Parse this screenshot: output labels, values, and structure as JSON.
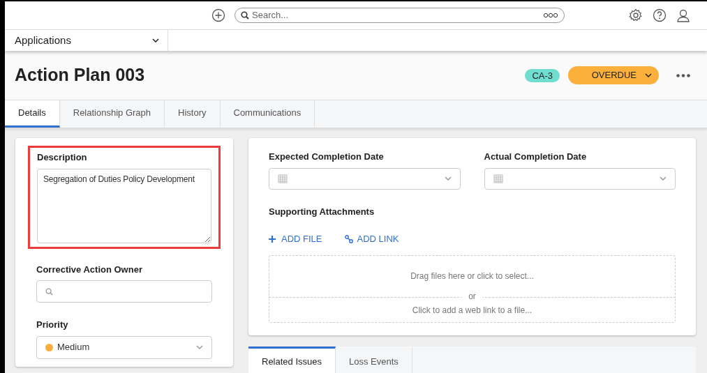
{
  "top_bar": {
    "search": {
      "placeholder": "Search..."
    }
  },
  "app_menu": {
    "label": "Applications"
  },
  "header": {
    "title": "Action Plan 003",
    "badge": "CA-3",
    "status": "OVERDUE"
  },
  "tabs": [
    {
      "label": "Details",
      "selected": true
    },
    {
      "label": "Relationship Graph",
      "selected": false
    },
    {
      "label": "History",
      "selected": false
    },
    {
      "label": "Communications",
      "selected": false
    }
  ],
  "left_card": {
    "description": {
      "label": "Description",
      "value": "Segregation of Duties Policy Development",
      "highlighted": true
    },
    "owner": {
      "label": "Corrective Action Owner"
    },
    "priority": {
      "label": "Priority",
      "value": "Medium",
      "color": "#f9ae3c"
    }
  },
  "right_card": {
    "dates": [
      {
        "label": "Expected Completion Date"
      },
      {
        "label": "Actual Completion Date"
      }
    ],
    "attachments": {
      "label": "Supporting Attachments",
      "add_file": "ADD FILE",
      "add_link": "ADD LINK",
      "drop_text": "Drag files here or click to select...",
      "separator": "or",
      "link_text": "Click to add a web link to a file..."
    }
  },
  "lower_tabs": [
    {
      "label": "Related Issues",
      "selected": true
    },
    {
      "label": "Loss Events",
      "selected": false
    }
  ]
}
